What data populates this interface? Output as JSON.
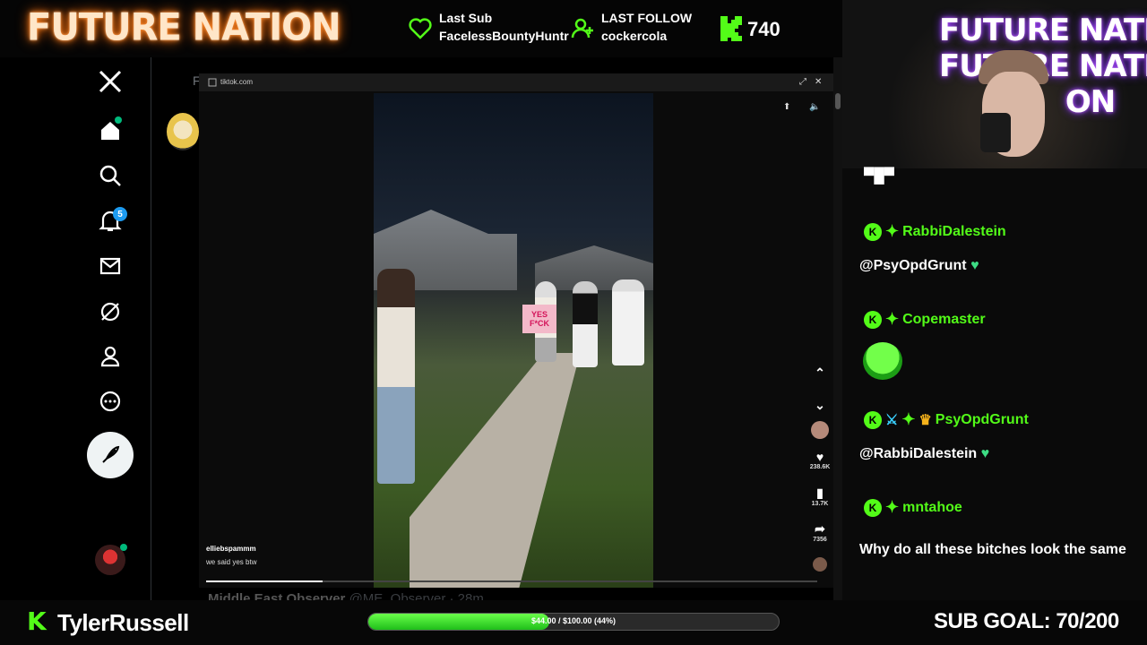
{
  "overlay": {
    "brand": "FUTURE NATION",
    "last_sub_label": "Last Sub",
    "last_sub_value": "FacelessBountyHuntr",
    "last_follow_label": "LAST FOLLOW",
    "last_follow_value": "cockercola",
    "kick_count": "740",
    "colors": {
      "kick_green": "#53fc18",
      "brand_glow": "#ff6a00"
    }
  },
  "x_sidebar": {
    "icons": [
      "x-logo-icon",
      "home-icon",
      "search-icon",
      "bell-icon",
      "mail-icon",
      "grok-icon",
      "profile-icon",
      "more-icon",
      "post-icon"
    ],
    "notification_count": "5"
  },
  "x_main": {
    "tab_letter": "F",
    "tweet_author": "Middle East Observer",
    "tweet_handle": "@ME_Observer · 28m"
  },
  "tiktok_popup": {
    "url": "tiktok.com",
    "video_user": "elliebspammm",
    "video_caption": "we said yes btw",
    "sign_text": "YES F*CK",
    "likes": "238.6K",
    "bookmarks": "13.7K",
    "shares": "7356",
    "progress_fraction": 0.19
  },
  "webcam": {
    "sign_lines": "FUTURE NATION\nFUTURE NATION\n             ON"
  },
  "chat": {
    "messages": [
      {
        "user": "RabbiDalestein",
        "text": "@PsyOpdGrunt"
      },
      {
        "user": "Copemaster",
        "text": ""
      },
      {
        "user": "PsyOpdGrunt",
        "text": "@RabbiDalestein"
      },
      {
        "user": "mntahoe",
        "text": "Why do all these bitches look the same"
      }
    ]
  },
  "bottom": {
    "username": "TylerRussell",
    "goal_text": "$44.00 / $100.00 (44%)",
    "goal_fraction": 0.44,
    "sub_goal": "SUB GOAL: 70/200"
  }
}
